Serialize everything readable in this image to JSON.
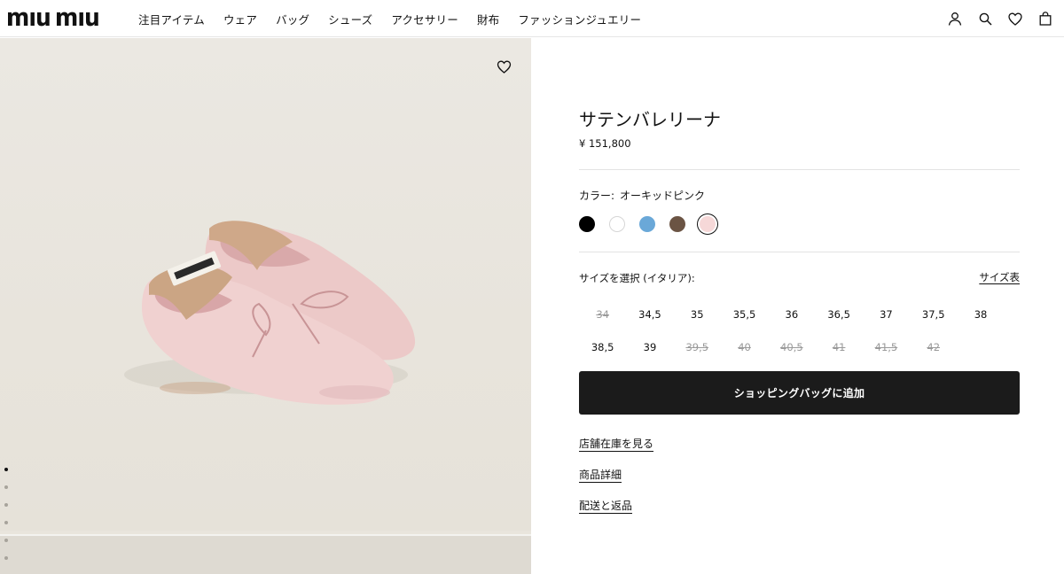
{
  "brand": {
    "logo_text": "miu miu"
  },
  "nav": {
    "items": [
      "注目アイテム",
      "ウェア",
      "バッグ",
      "シューズ",
      "アクセサリー",
      "財布",
      "ファッションジュエリー"
    ]
  },
  "header_icons": [
    "user-icon",
    "search-icon",
    "heart-icon",
    "shopping-bag-icon"
  ],
  "gallery": {
    "image_alt": "Pink satin ballerina flats",
    "wishlist_icon": "heart-icon",
    "pagination_count": 6,
    "pagination_active": 1
  },
  "product": {
    "title": "サテンバレリーナ",
    "price": "¥ 151,800",
    "color_label": "カラー:",
    "color_value": "オーキッドピンク",
    "colors": [
      {
        "hex": "#000000",
        "name": "black"
      },
      {
        "hex": "#ffffff",
        "name": "white"
      },
      {
        "hex": "#6aa8d8",
        "name": "light-blue"
      },
      {
        "hex": "#6b5444",
        "name": "brown"
      },
      {
        "hex": "#f6d8d8",
        "name": "orchid-pink",
        "selected": true
      }
    ],
    "size_label": "サイズを選択 (イタリア):",
    "size_chart_link": "サイズ表",
    "sizes": [
      {
        "label": "34",
        "available": false
      },
      {
        "label": "34,5",
        "available": true
      },
      {
        "label": "35",
        "available": true
      },
      {
        "label": "35,5",
        "available": true
      },
      {
        "label": "36",
        "available": true
      },
      {
        "label": "36,5",
        "available": true
      },
      {
        "label": "37",
        "available": true
      },
      {
        "label": "37,5",
        "available": true
      },
      {
        "label": "38",
        "available": true
      },
      {
        "label": "38,5",
        "available": true
      },
      {
        "label": "39",
        "available": true
      },
      {
        "label": "39,5",
        "available": false
      },
      {
        "label": "40",
        "available": false
      },
      {
        "label": "40,5",
        "available": false
      },
      {
        "label": "41",
        "available": false
      },
      {
        "label": "41,5",
        "available": false
      },
      {
        "label": "42",
        "available": false
      }
    ],
    "add_to_bag": "ショッピングバッグに追加",
    "links": [
      "店舗在庫を見る",
      "商品詳細",
      "配送と返品"
    ]
  }
}
